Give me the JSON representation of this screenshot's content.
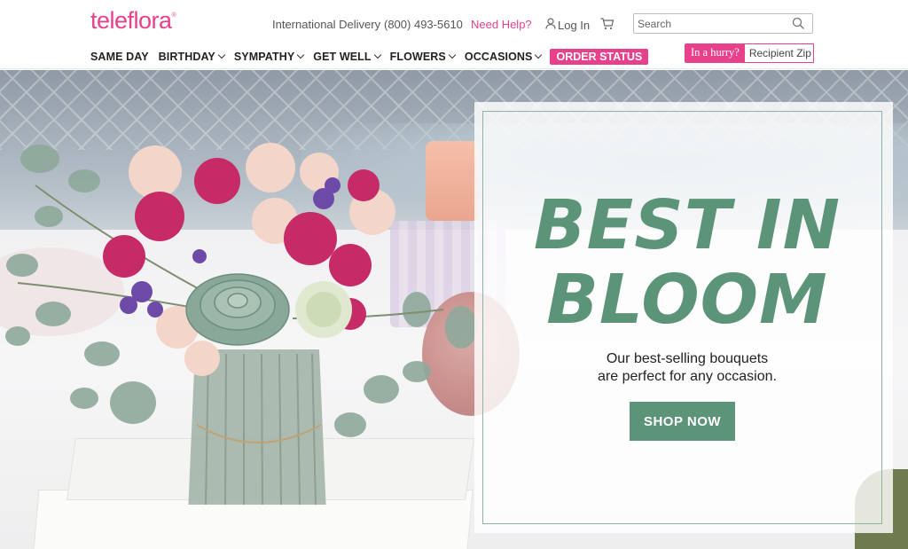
{
  "brand": {
    "name": "teleflora",
    "reg": "®",
    "color": "#e8418b"
  },
  "utility": {
    "international": "International Delivery",
    "phone": "(800) 493-5610",
    "help": "Need Help?",
    "login": "Log In",
    "cart_icon": "cart-icon",
    "user_icon": "user-icon"
  },
  "search": {
    "placeholder": "Search",
    "icon": "search-icon"
  },
  "nav": {
    "items": [
      {
        "label": "SAME DAY",
        "dropdown": false
      },
      {
        "label": "BIRTHDAY",
        "dropdown": true
      },
      {
        "label": "SYMPATHY",
        "dropdown": true
      },
      {
        "label": "GET WELL",
        "dropdown": true
      },
      {
        "label": "FLOWERS",
        "dropdown": true
      },
      {
        "label": "OCCASIONS",
        "dropdown": true
      }
    ],
    "order_status": "ORDER STATUS"
  },
  "hurry": {
    "label": "In a hurry?",
    "placeholder": "Recipient Zip"
  },
  "hero": {
    "title_line1": "BEST IN",
    "title_line2": "BLOOM",
    "subtitle_line1": "Our best-selling bouquets",
    "subtitle_line2": "are perfect for any occasion.",
    "cta": "SHOP NOW",
    "accent": "#5b9478"
  }
}
